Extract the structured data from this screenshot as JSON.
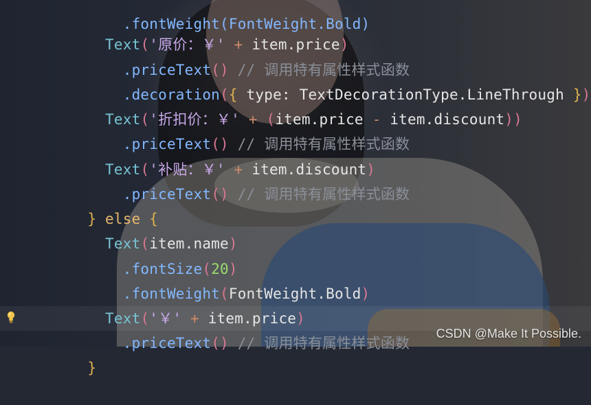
{
  "code": {
    "lines": [
      {
        "tokens": [
          {
            "text": "    .fontWeight(FontWeight.Bold)"
          }
        ]
      },
      {
        "tokens": [
          {
            "text": "  Text"
          },
          {
            "text": "("
          },
          {
            "text": "'原价：￥'"
          },
          {
            "text": " + "
          },
          {
            "text": "item.price"
          },
          {
            "text": ")"
          }
        ]
      },
      {
        "tokens": [
          {
            "text": "    .priceText"
          },
          {
            "text": "()"
          },
          {
            "text": " // 调用特有属性样式函数"
          }
        ]
      },
      {
        "tokens": [
          {
            "text": "    .decoration"
          },
          {
            "text": "("
          },
          {
            "text": "{"
          },
          {
            "text": " type: TextDecorationType.LineThrough "
          },
          {
            "text": "}"
          },
          {
            "text": ")"
          }
        ]
      },
      {
        "tokens": [
          {
            "text": "  Text"
          },
          {
            "text": "("
          },
          {
            "text": "'折扣价：￥'"
          },
          {
            "text": " + "
          },
          {
            "text": "("
          },
          {
            "text": "item.price"
          },
          {
            "text": " - "
          },
          {
            "text": "item.discount"
          },
          {
            "text": ")"
          },
          {
            "text": ")"
          }
        ]
      },
      {
        "tokens": [
          {
            "text": "    .priceText"
          },
          {
            "text": "()"
          },
          {
            "text": " // 调用特有属性样式函数"
          }
        ]
      },
      {
        "tokens": [
          {
            "text": "  Text"
          },
          {
            "text": "("
          },
          {
            "text": "'补贴：￥'"
          },
          {
            "text": " + "
          },
          {
            "text": "item.discount"
          },
          {
            "text": ")"
          }
        ]
      },
      {
        "tokens": [
          {
            "text": "    .priceText"
          },
          {
            "text": "()"
          },
          {
            "text": " // 调用特有属性样式函数"
          }
        ]
      },
      {
        "tokens": [
          {
            "text": "}"
          },
          {
            "text": " else "
          },
          {
            "text": "{"
          }
        ]
      },
      {
        "tokens": [
          {
            "text": "  Text"
          },
          {
            "text": "("
          },
          {
            "text": "item.name"
          },
          {
            "text": ")"
          }
        ]
      },
      {
        "tokens": [
          {
            "text": "    .fontSize"
          },
          {
            "text": "("
          },
          {
            "text": "20"
          },
          {
            "text": ")"
          }
        ]
      },
      {
        "tokens": [
          {
            "text": "    .fontWeight"
          },
          {
            "text": "("
          },
          {
            "text": "FontWeight.Bold"
          },
          {
            "text": ")"
          }
        ]
      },
      {
        "tokens": [
          {
            "text": "  Text"
          },
          {
            "text": "("
          },
          {
            "text": "'￥'"
          },
          {
            "text": " + "
          },
          {
            "text": "item.price"
          },
          {
            "text": ")"
          }
        ]
      },
      {
        "tokens": [
          {
            "text": "    .priceText"
          },
          {
            "text": "()"
          },
          {
            "text": " // 调用特有属性样式函数"
          }
        ]
      },
      {
        "tokens": [
          {
            "text": "}"
          }
        ]
      }
    ]
  },
  "gutter": {
    "icon": "lightbulb-icon"
  },
  "watermark": {
    "text": "CSDN @Make It Possible."
  }
}
